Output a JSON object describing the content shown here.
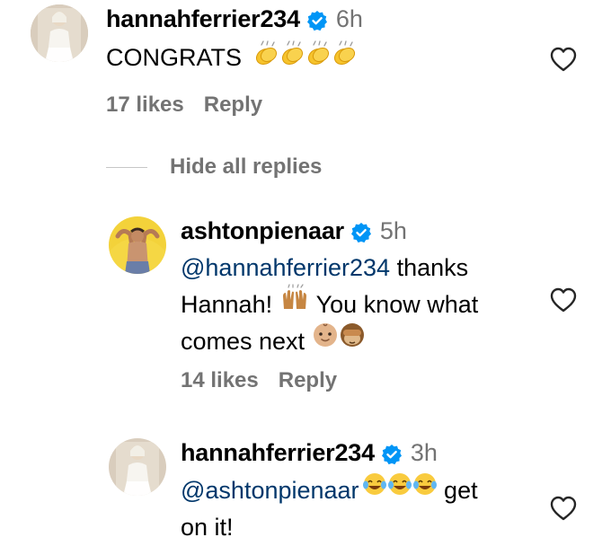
{
  "comments": [
    {
      "username": "hannahferrier234",
      "time": "6h",
      "text": "CONGRATS",
      "emoji": "clapping-hands x4",
      "likes": "17 likes",
      "reply": "Reply"
    }
  ],
  "toggle_replies": "Hide all replies",
  "replies": [
    {
      "username": "ashtonpienaar",
      "time": "5h",
      "mention": "@hannahferrier234",
      "text_line1_rest": " thanks",
      "text_line2_a": "Hannah! ",
      "text_line2_b": " You know what",
      "text_line3": "comes next ",
      "likes": "14 likes",
      "reply": "Reply"
    },
    {
      "username": "hannahferrier234",
      "time": "3h",
      "mention": "@ashtonpienaar",
      "text_line1_rest": " get",
      "text_line2": "on it!",
      "emoji": "tears-of-joy x3"
    }
  ],
  "colors": {
    "secondary_text": "#737373",
    "mention": "#00376b",
    "verified_badge": "#0095f6"
  },
  "icons": [
    "verified-badge-icon",
    "heart-outline-icon",
    "clapping-hands-emoji",
    "raising-hands-emoji",
    "baby-emoji",
    "see-no-evil-monkey-emoji",
    "tears-of-joy-emoji"
  ]
}
